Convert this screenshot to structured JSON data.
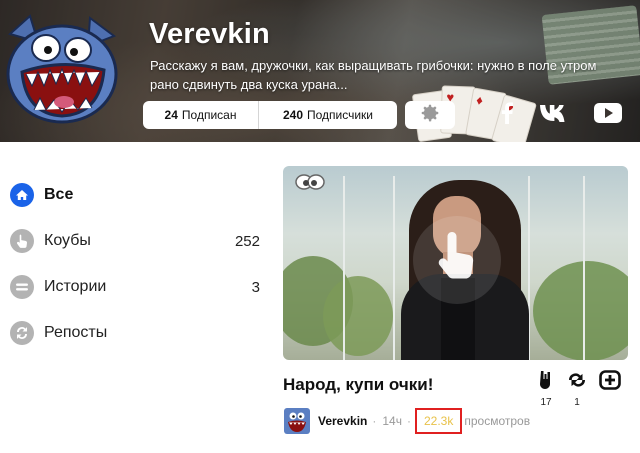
{
  "channel": {
    "name": "Verevkin",
    "description": "Расскажу я вам, дружочки, как выращивать грибочки: нужно в поле утром рано сдвинуть два куска урана...",
    "following": {
      "count": "24",
      "label": "Подписан"
    },
    "followers": {
      "count": "240",
      "label": "Подписчики"
    },
    "settings_icon": "gear-icon",
    "social_icons": [
      "facebook-icon",
      "vk-icon",
      "youtube-icon"
    ]
  },
  "nav": {
    "items": [
      {
        "label": "Все",
        "count": "",
        "icon": "home-icon",
        "active": true
      },
      {
        "label": "Коубы",
        "count": "252",
        "icon": "hand-icon",
        "active": false
      },
      {
        "label": "Истории",
        "count": "3",
        "icon": "list-icon",
        "active": false
      },
      {
        "label": "Репосты",
        "count": "",
        "icon": "repost-icon",
        "active": false
      }
    ]
  },
  "coub": {
    "title": "Народ, купи очки!",
    "author": "Verevkin",
    "time": "14ч",
    "separator": "·",
    "views": "22.3k",
    "views_label": "просмотров",
    "likes": "17",
    "recoubs": "1"
  },
  "colors": {
    "accent": "#1a63e8",
    "nav_icon_gray": "#b3b3b3",
    "views_highlight": "#e8c24a",
    "highlight_box": "#e02020"
  }
}
